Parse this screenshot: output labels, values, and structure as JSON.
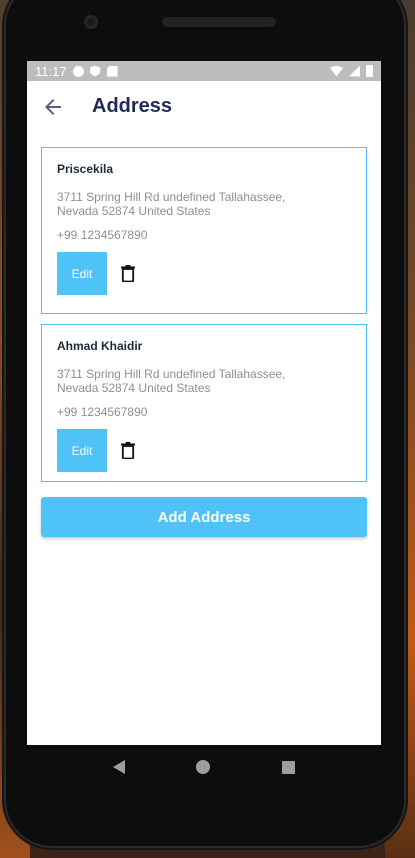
{
  "status_bar": {
    "time": "11:17"
  },
  "header": {
    "title": "Address"
  },
  "addresses": [
    {
      "name": "Priscekila",
      "address": "3711 Spring Hill Rd undefined Tallahassee, Nevada 52874 United States",
      "phone": "+99 1234567890",
      "edit_label": "Edit"
    },
    {
      "name": "Ahmad Khaidir",
      "address": "3711 Spring Hill Rd undefined Tallahassee, Nevada 52874 United States",
      "phone": "+99 1234567890",
      "edit_label": "Edit"
    }
  ],
  "add_button_label": "Add Address",
  "colors": {
    "accent": "#4fc3f7",
    "title": "#1e2a5a",
    "muted_text": "#8a8f99"
  }
}
